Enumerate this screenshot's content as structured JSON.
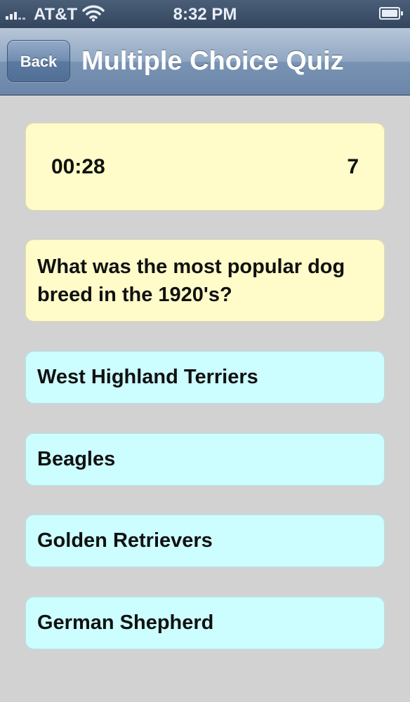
{
  "status_bar": {
    "carrier": "AT&T",
    "time": "8:32 PM",
    "signal_icon": "signal-bars-icon",
    "wifi_icon": "wifi-icon",
    "battery_icon": "battery-icon"
  },
  "nav": {
    "back_label": "Back",
    "title": "Multiple Choice Quiz"
  },
  "quiz": {
    "timer": "00:28",
    "score": "7",
    "question": "What was the most popular dog breed in the 1920's?",
    "answers": [
      "West Highland Terriers",
      "Beagles",
      "Golden Retrievers",
      "German Shepherd"
    ]
  },
  "colors": {
    "background": "#d2d2d2",
    "nav_bar": "#7f98b8",
    "yellow_card": "#fffcc9",
    "answer_card": "#ccfdff",
    "text": "#111111"
  }
}
